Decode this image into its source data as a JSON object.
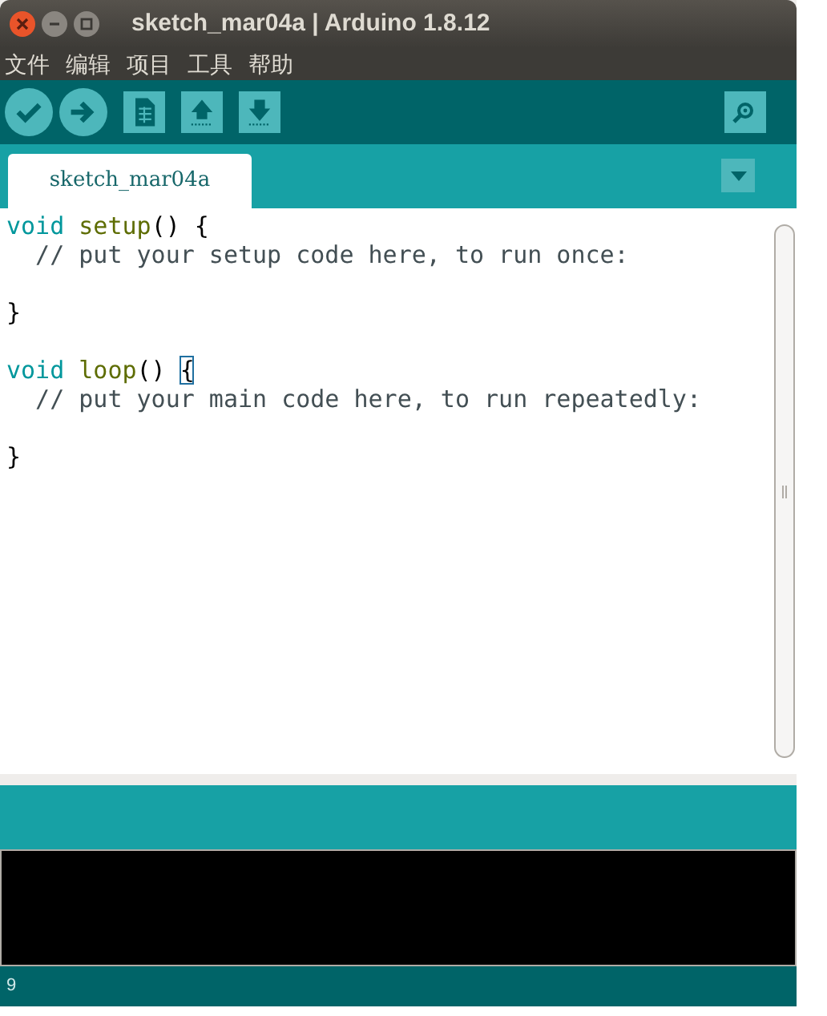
{
  "window": {
    "title": "sketch_mar04a | Arduino 1.8.12"
  },
  "menu": [
    "文件",
    "编辑",
    "项目",
    "工具",
    "帮助"
  ],
  "toolbar": [
    {
      "kind": "verify"
    },
    {
      "kind": "upload"
    },
    {
      "kind": "new"
    },
    {
      "kind": "open"
    },
    {
      "kind": "save"
    }
  ],
  "tabs": [
    {
      "label": "sketch_mar04a",
      "selected": true
    }
  ],
  "code": [
    {
      "kind": "line",
      "tokens": [
        {
          "kind": "keyword",
          "text": "void "
        },
        {
          "kind": "function",
          "text": "setup"
        },
        {
          "kind": "plain",
          "text": "() {"
        }
      ]
    },
    {
      "kind": "line",
      "tokens": [
        {
          "kind": "comment",
          "text": "  // put your setup code here, to run once:"
        }
      ]
    },
    {
      "kind": "blank"
    },
    {
      "kind": "line",
      "tokens": [
        {
          "kind": "plain",
          "text": "}"
        }
      ]
    },
    {
      "kind": "blank"
    },
    {
      "kind": "line",
      "tokens": [
        {
          "kind": "keyword",
          "text": "void "
        },
        {
          "kind": "function",
          "text": "loop"
        },
        {
          "kind": "plain",
          "text": "() "
        },
        {
          "kind": "match",
          "text": "{"
        }
      ]
    },
    {
      "kind": "line",
      "tokens": [
        {
          "kind": "comment",
          "text": "  // put your main code here, to run repeatedly:"
        }
      ]
    },
    {
      "kind": "blank"
    },
    {
      "kind": "line",
      "tokens": [
        {
          "kind": "plain",
          "text": "}"
        }
      ]
    }
  ],
  "status_bar": {
    "line": "9"
  }
}
